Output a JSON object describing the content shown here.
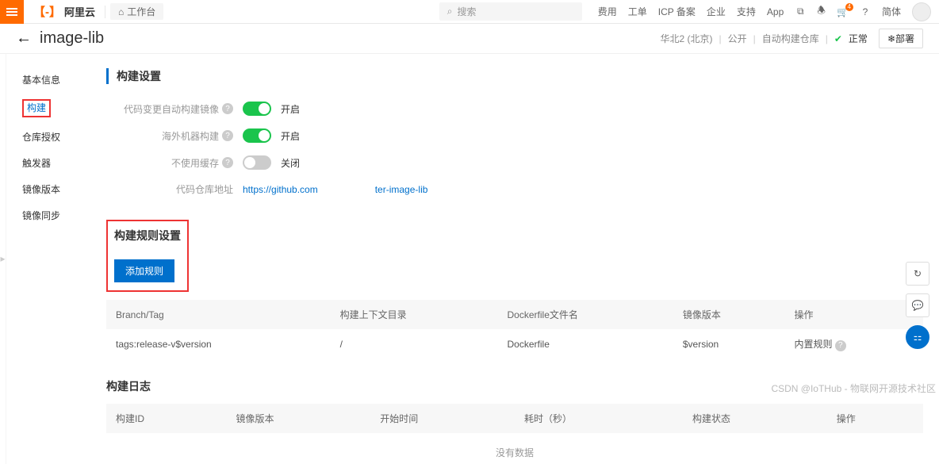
{
  "top": {
    "brand": "阿里云",
    "workbench": "工作台",
    "search_placeholder": "搜索",
    "links": [
      "费用",
      "工单",
      "ICP 备案",
      "企业",
      "支持",
      "App"
    ],
    "cart_badge": "4",
    "lang": "简体"
  },
  "page": {
    "title": "image-lib",
    "region": "华北2 (北京)",
    "visibility": "公开",
    "repo_type": "自动构建仓库",
    "status": "正常",
    "deploy_btn": "❄部署"
  },
  "sidenav": {
    "items": [
      "基本信息",
      "构建",
      "仓库授权",
      "触发器",
      "镜像版本",
      "镜像同步"
    ],
    "active_index": 1
  },
  "build_settings": {
    "title": "构建设置",
    "rows": [
      {
        "label": "代码变更自动构建镜像",
        "on": true,
        "state": "开启"
      },
      {
        "label": "海外机器构建",
        "on": true,
        "state": "开启"
      },
      {
        "label": "不使用缓存",
        "on": false,
        "state": "关闭"
      }
    ],
    "repo_label": "代码仓库地址",
    "repo_link": "https://github.com",
    "repo_suffix": "ter-image-lib"
  },
  "rules": {
    "title": "构建规则设置",
    "add_btn": "添加规则",
    "cols": [
      "Branch/Tag",
      "构建上下文目录",
      "Dockerfile文件名",
      "镜像版本",
      "操作"
    ],
    "row": {
      "branch": "tags:release-v$version",
      "context": "/",
      "dockerfile": "Dockerfile",
      "version": "$version",
      "action": "内置规则"
    }
  },
  "logs": {
    "title": "构建日志",
    "cols": [
      "构建ID",
      "镜像版本",
      "开始时间",
      "耗时（秒）",
      "构建状态",
      "操作"
    ],
    "nodata": "没有数据"
  },
  "watermark": "CSDN @IoTHub - 物联网开源技术社区"
}
